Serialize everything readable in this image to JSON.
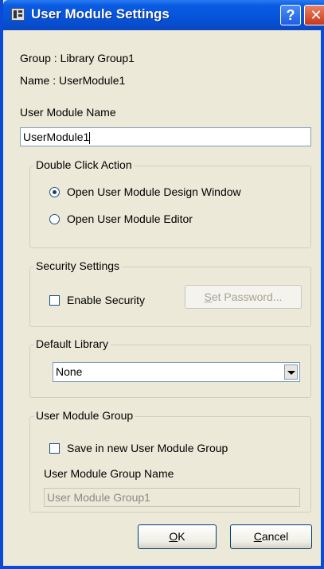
{
  "window": {
    "title": "User Module Settings"
  },
  "info": {
    "group": "Group : Library Group1",
    "name": "Name : UserModule1"
  },
  "module_name": {
    "label": "User Module Name",
    "value": "UserModule1"
  },
  "double_click": {
    "legend": "Double Click Action",
    "options": [
      {
        "label": "Open User Module Design Window",
        "selected": true
      },
      {
        "label": "Open User Module Editor",
        "selected": false
      }
    ]
  },
  "security": {
    "legend": "Security Settings",
    "enable_label": "Enable Security",
    "enable_checked": false,
    "set_password_accel": "S",
    "set_password_rest": "et Password..."
  },
  "default_library": {
    "legend": "Default Library",
    "selected": "None"
  },
  "module_group": {
    "legend": "User Module Group",
    "save_label": "Save in new User Module Group",
    "save_checked": false,
    "name_label": "User Module Group Name",
    "name_value": "User Module Group1"
  },
  "buttons": {
    "ok_accel": "O",
    "ok_rest": "K",
    "cancel_accel": "C",
    "cancel_rest": "ancel"
  },
  "icons": {
    "app": "grid-window-icon",
    "help": "question-icon",
    "close": "close-x-icon"
  },
  "colors": {
    "titlebar": "#0553d9",
    "dialog_bg": "#ece9d8",
    "close_button": "#c9371a"
  }
}
